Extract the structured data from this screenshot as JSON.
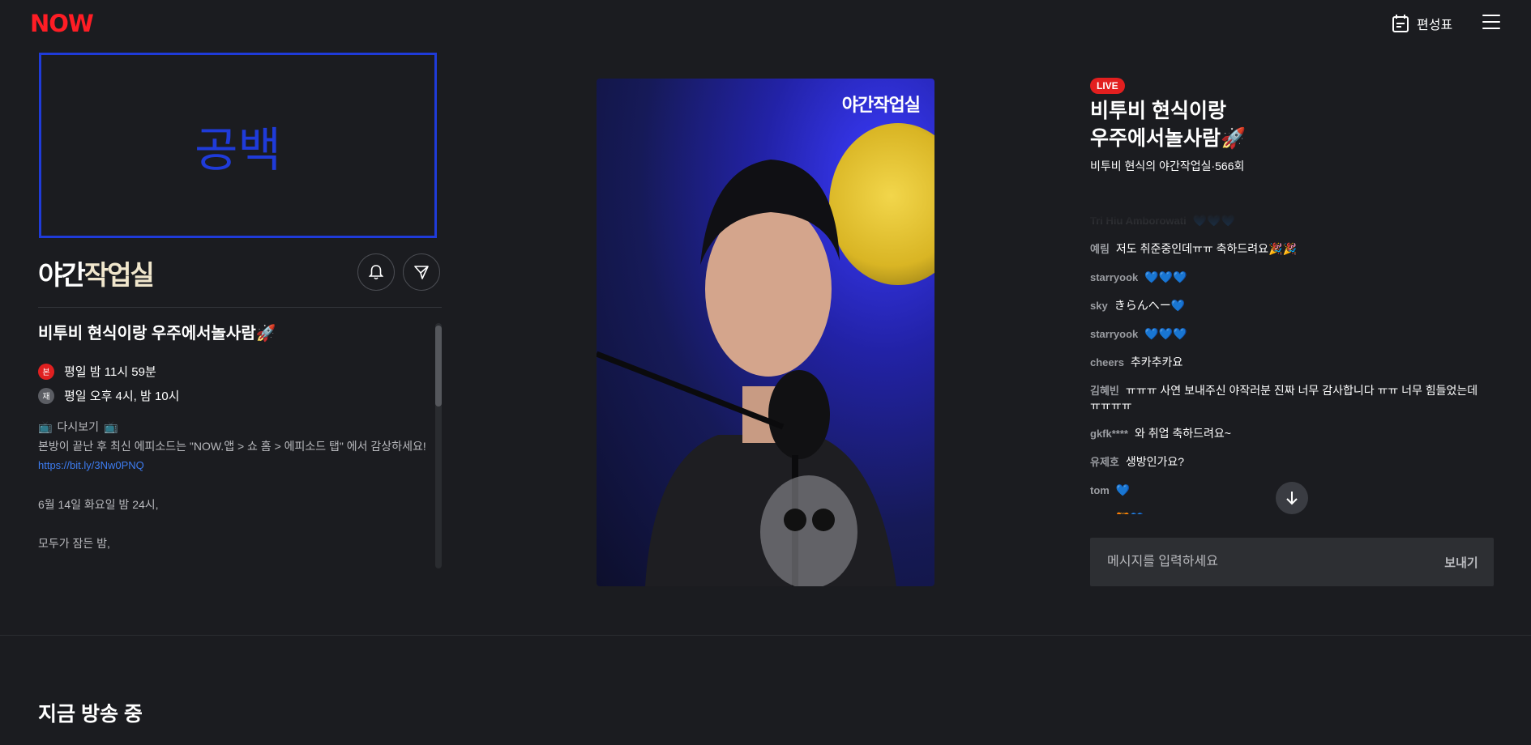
{
  "header": {
    "logo": "NOW",
    "schedule_label": "편성표"
  },
  "placeholder": {
    "label": "공백"
  },
  "show": {
    "logo_text_a": "야간",
    "logo_text_b": "작업실",
    "title": "비투비 현식이랑 우주에서놀사람🚀",
    "schedule": [
      {
        "badge": "본",
        "text": "평일 밤 11시 59분"
      },
      {
        "badge": "재",
        "text": "평일 오후 4시, 밤 10시"
      }
    ],
    "replay_label": "다시보기",
    "description": "본방이 끝난 후 최신 에피소드는 \"NOW.앱 > 쇼 홈 > 에피소드 탭\" 에서 감상하세요!",
    "link": "https://bit.ly/3Nw0PNQ",
    "line1": "6월 14일 화요일 밤 24시,",
    "line2": "모두가 잠든 밤,"
  },
  "video": {
    "watermark": "야간작업실"
  },
  "live": {
    "badge": "LIVE",
    "title_line1": "비투비 현식이랑",
    "title_line2": "우주에서놀사람🚀",
    "subtitle": "비투비 현식의 야간작업실·566회"
  },
  "chat": {
    "messages": [
      {
        "user": "Tri Hiu Amborowati",
        "text": "💙💙💙"
      },
      {
        "user": "예림",
        "text": "저도 취준중인데ㅠㅠ 축하드려요🎉🎉"
      },
      {
        "user": "starryook",
        "text": "💙💙💙"
      },
      {
        "user": "sky",
        "text": "きらんへー💙"
      },
      {
        "user": "starryook",
        "text": "💙💙💙"
      },
      {
        "user": "cheers",
        "text": "추카추카요"
      },
      {
        "user": "김혜빈",
        "text": "ㅠㅠㅠ 사연 보내주신 야작러분 진짜 너무 감사합니다 ㅠㅠ 너무 힘들었는데 ㅠㅠㅠㅠ"
      },
      {
        "user": "gkfk****",
        "text": "와 취업 축하드려요~"
      },
      {
        "user": "유제호",
        "text": "생방인가요?"
      },
      {
        "user": "tom",
        "text": "💙"
      },
      {
        "user": "tom",
        "text": "🐯💙"
      }
    ],
    "input_placeholder": "메시지를 입력하세요",
    "send_label": "보내기"
  },
  "section": {
    "title": "지금 방송 중"
  },
  "colors": {
    "accent_red": "#ff1d25",
    "live_red": "#e21f1f",
    "placeholder_blue": "#1f3bd9",
    "link_blue": "#3d7cf0"
  }
}
